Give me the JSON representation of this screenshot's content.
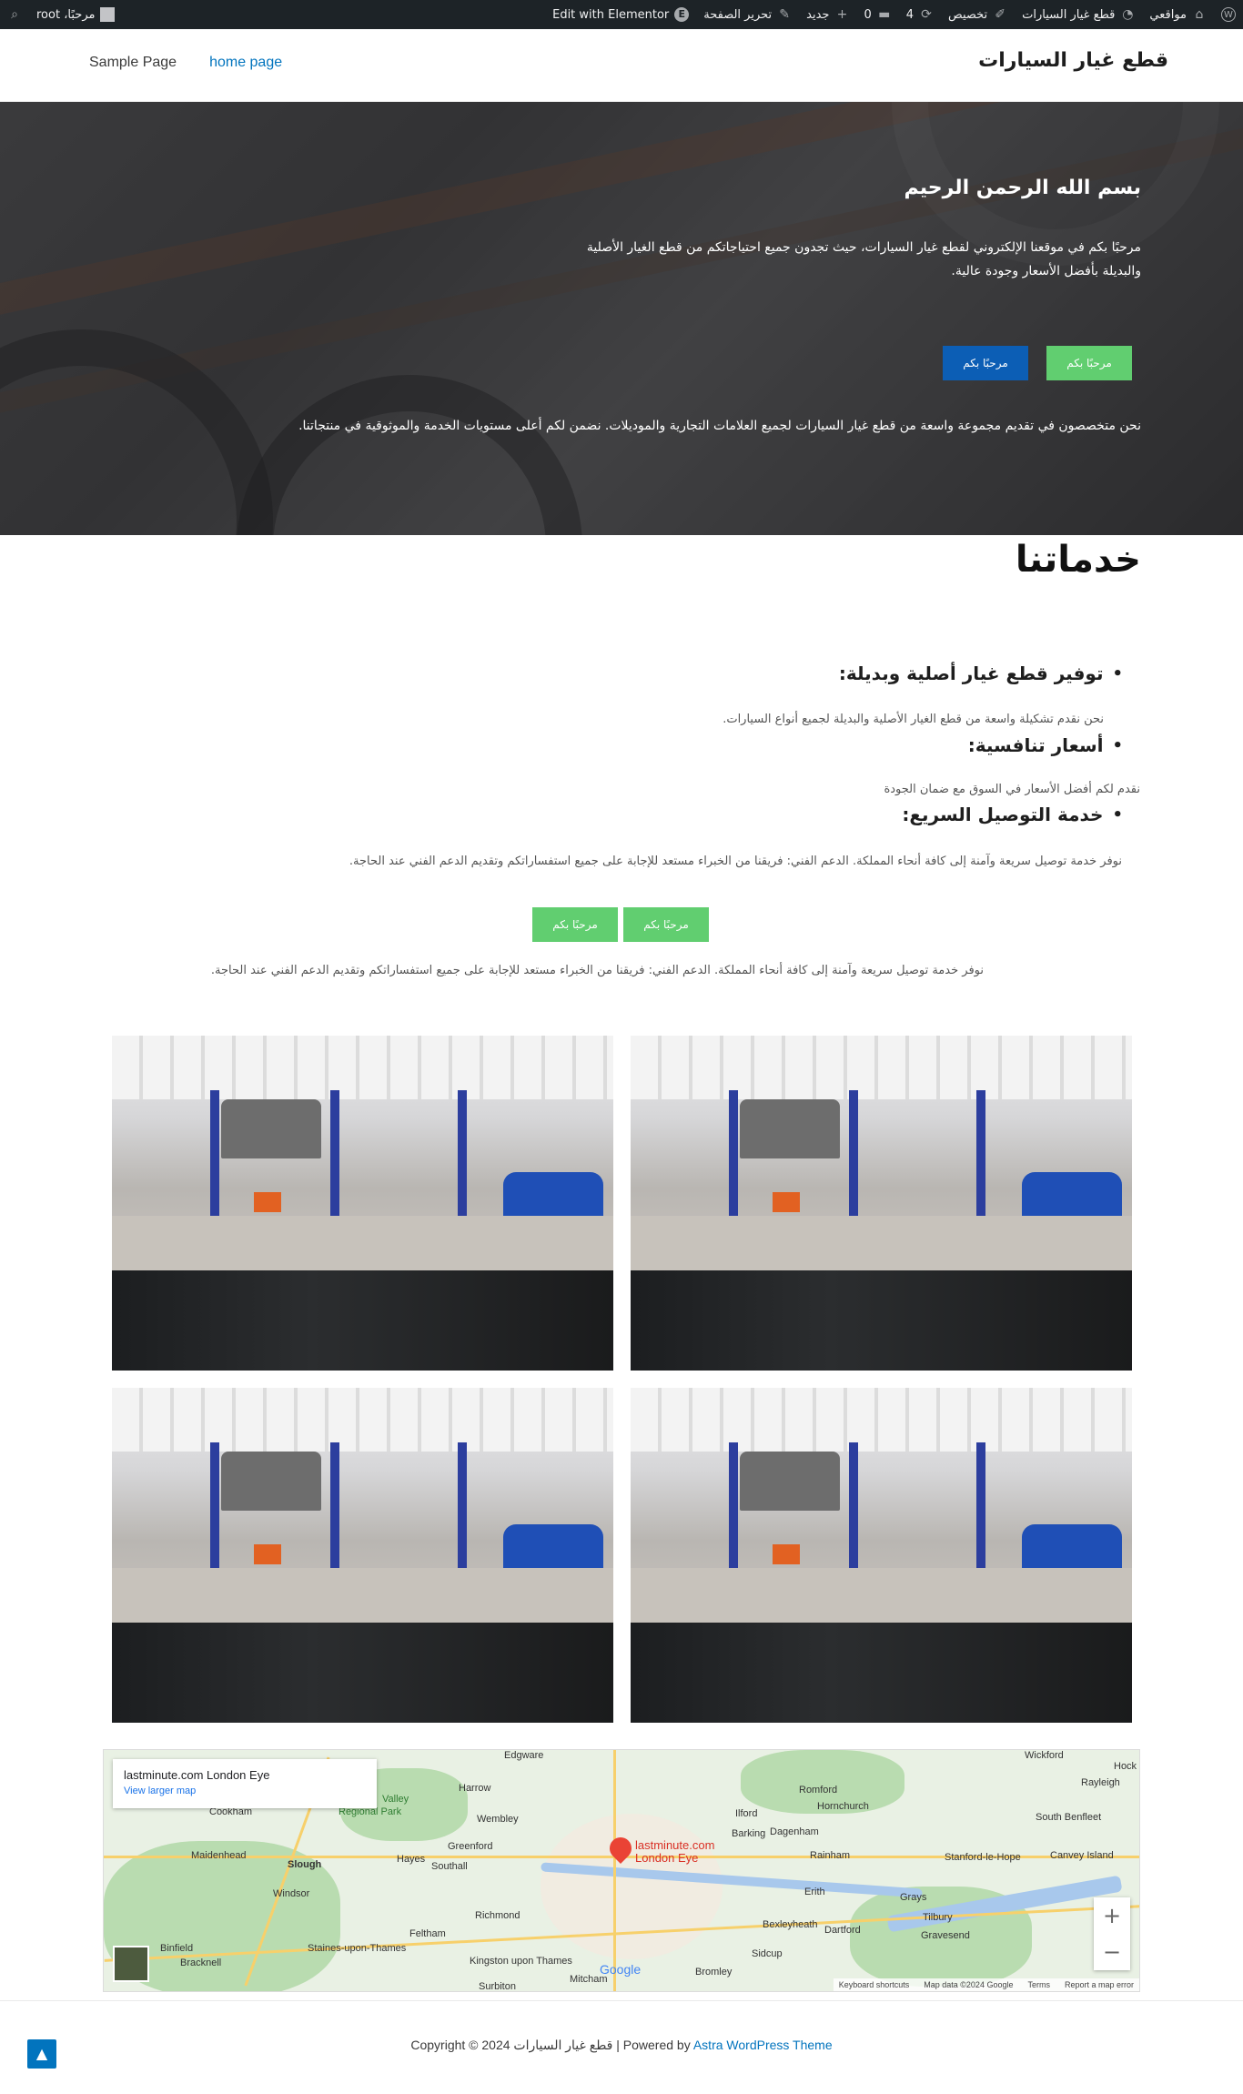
{
  "adminbar": {
    "my_sites": "مواقعي",
    "site_name": "قطع غيار السيارات",
    "customize": "تخصيص",
    "updates_count": "4",
    "comments_count": "0",
    "new": "جديد",
    "edit_page": "تحرير الصفحة",
    "elementor": "Edit with Elementor",
    "greeting": "مرحبًا، root"
  },
  "header": {
    "site_title": "قطع غيار السيارات",
    "nav": [
      "Sample Page",
      "home page"
    ]
  },
  "hero": {
    "title": "بسم الله الرحمن الرحيم",
    "text": "مرحبًا بكم في موقعنا الإلكتروني لقطع غيار السيارات، حيث تجدون جميع احتياجاتكم من قطع الغيار الأصلية والبديلة بأفضل الأسعار وجودة عالية.",
    "button_primary": "مرحبًا بكم",
    "button_secondary": "مرحبًا بكم",
    "bottom_text": "نحن متخصصون في تقديم مجموعة واسعة من قطع غيار السيارات لجميع العلامات التجارية والموديلات. نضمن لكم أعلى مستويات الخدمة والموثوقية في منتجاتنا."
  },
  "services": {
    "title": "خدماتنا",
    "items": [
      {
        "heading": "توفير قطع غيار أصلية وبديلة:",
        "text": "نحن نقدم تشكيلة واسعة من قطع الغيار الأصلية والبديلة لجميع أنواع السيارات."
      },
      {
        "heading": "أسعار تنافسية:",
        "text": "نقدم لكم أفضل الأسعار في السوق مع ضمان الجودة"
      },
      {
        "heading": "خدمة التوصيل السريع:",
        "text": "نوفر خدمة توصيل سريعة وآمنة إلى كافة أنحاء المملكة. الدعم الفني: فريقنا من الخبراء مستعد للإجابة على جميع استفساراتكم وتقديم الدعم الفني عند الحاجة."
      }
    ],
    "buttons": [
      "مرحبًا بكم",
      "مرحبًا بكم"
    ],
    "closing_text": "نوفر خدمة توصيل سريعة وآمنة إلى كافة أنحاء المملكة. الدعم الفني: فريقنا من الخبراء مستعد للإجابة على جميع استفساراتكم وتقديم الدعم الفني عند الحاجة."
  },
  "map": {
    "place": "lastminute.com London Eye",
    "larger_map": "View larger map",
    "pin_label_1": "lastminute.com",
    "pin_label_2": "London Eye",
    "labels": [
      "Edgware",
      "Harrow",
      "Wembley",
      "Greenford",
      "Southall",
      "Hayes",
      "Slough",
      "Maidenhead",
      "Windsor",
      "Richmond",
      "Feltham",
      "Staines-upon-Thames",
      "Kingston upon Thames",
      "Surbiton",
      "Mitcham",
      "Sidcup",
      "Bexleyheath",
      "Dartford",
      "Grays",
      "Tilbury",
      "Gravesend",
      "Erith",
      "Rainham",
      "Romford",
      "Hornchurch",
      "Ilford",
      "Barking",
      "Dagenham",
      "Wickford",
      "Rayleigh",
      "South Benfleet",
      "Canvey Island",
      "Stanford-le-Hope",
      "Cookham",
      "Bracknell",
      "Binfield",
      "Bromley",
      "Hock",
      "Regional Park",
      "Valley"
    ],
    "google": "Google",
    "footer": [
      "Keyboard shortcuts",
      "Map data ©2024 Google",
      "Terms",
      "Report a map error"
    ],
    "zoom_in": "+",
    "zoom_out": "−"
  },
  "footer": {
    "copyright": "Copyright © 2024 قطع غيار السيارات | Powered by ",
    "theme_link": "Astra WordPress Theme",
    "scroll_top": "▲"
  }
}
